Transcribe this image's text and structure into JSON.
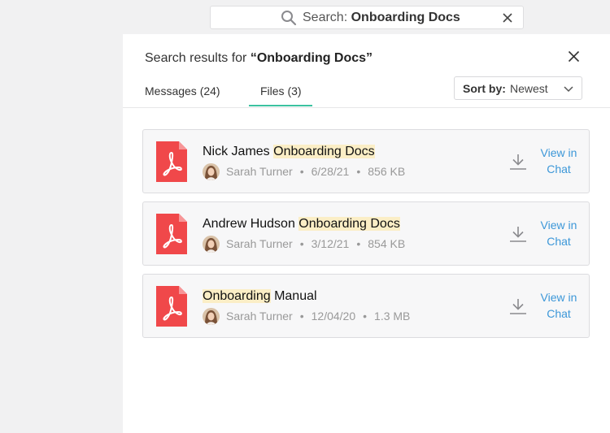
{
  "search": {
    "prefix": "Search:",
    "query": "Onboarding Docs",
    "icon": "search-icon",
    "clear_icon": "close-icon"
  },
  "panel": {
    "title_prefix": "Search results for ",
    "title_query": "“Onboarding Docs”",
    "tabs": [
      {
        "label": "Messages (24)",
        "active": false
      },
      {
        "label": "Files (3)",
        "active": true
      }
    ],
    "sort": {
      "label": "Sort by:",
      "value": "Newest"
    },
    "accent_color": "#3cc2a0",
    "link_color": "#3c97d8",
    "highlight_color": "#fbeec6"
  },
  "files": [
    {
      "name_pre": "Nick James ",
      "name_hl": "Onboarding Docs",
      "name_post": "",
      "author": "Sarah Turner",
      "date": "6/28/21",
      "size": "856 KB",
      "view_line1": "View in",
      "view_line2": "Chat"
    },
    {
      "name_pre": "Andrew Hudson ",
      "name_hl": "Onboarding Docs",
      "name_post": "",
      "author": "Sarah Turner",
      "date": "3/12/21",
      "size": "854 KB",
      "view_line1": "View in",
      "view_line2": "Chat"
    },
    {
      "name_pre": "",
      "name_hl": "Onboarding",
      "name_post": " Manual",
      "author": "Sarah Turner",
      "date": "12/04/20",
      "size": "1.3 MB",
      "view_line1": "View in",
      "view_line2": "Chat"
    }
  ],
  "separator": "•"
}
